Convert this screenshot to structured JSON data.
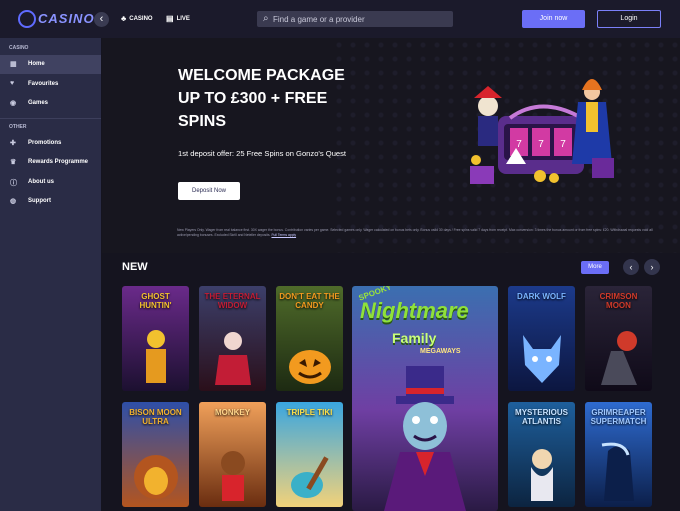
{
  "brand": {
    "logo_text": "CASINO"
  },
  "topnav": [
    {
      "label": "CASINO",
      "icon": "club-icon"
    },
    {
      "label": "LIVE",
      "icon": "cards-icon"
    }
  ],
  "search": {
    "placeholder": "Find a game or a provider"
  },
  "auth": {
    "join": "Join now",
    "login": "Login"
  },
  "sidebar": {
    "section1": "CASINO",
    "items1": [
      {
        "label": "Home",
        "icon": "grid-icon",
        "active": true
      },
      {
        "label": "Favourites",
        "icon": "heart-icon"
      },
      {
        "label": "Games",
        "icon": "gamepad-icon"
      }
    ],
    "section2": "OTHER",
    "items2": [
      {
        "label": "Promotions",
        "icon": "gift-icon"
      },
      {
        "label": "Rewards Programme",
        "icon": "trophy-icon"
      },
      {
        "label": "About us",
        "icon": "info-icon"
      },
      {
        "label": "Support",
        "icon": "support-icon"
      }
    ]
  },
  "hero": {
    "title_lines": [
      "WELCOME PACKAGE",
      "UP TO £300 + FREE",
      "SPINS"
    ],
    "subtitle": "1st deposit offer: 25 Free Spins on Gonzo's Quest",
    "cta": "Deposit Now",
    "terms": "New Players Only. Wager from real balance first. 30X wager the bonus. Contribution varies per game. Selected games only. Wager calculated on bonus bets only. Bonus valid 30 days / Free spins valid 7 days from receipt. Max conversion: 3 times the bonus amount or from free spins: £20. Withdrawal requests void all active/pending bonuses. Excluded Skrill and Neteller deposits.",
    "terms_link": "Full Terms apply"
  },
  "new_section": {
    "title": "NEW",
    "more": "More",
    "prev": "‹",
    "next": "›"
  },
  "games": [
    {
      "title": "GHOST HUNTIN'",
      "bg1": "#6a2a8a",
      "bg2": "#1c1030",
      "accent": "#f2c12e"
    },
    {
      "title": "THE ETERNAL WIDOW",
      "bg1": "#3c3f6a",
      "bg2": "#2a0f1a",
      "accent": "#c21d36"
    },
    {
      "title": "DON'T EAT THE CANDY",
      "bg1": "#4f6b2a",
      "bg2": "#1d2a12",
      "accent": "#f29a1f"
    },
    {
      "title": "DARK WOLF",
      "bg1": "#1c3a8a",
      "bg2": "#0c1640",
      "accent": "#7ab4ff"
    },
    {
      "title": "CRIMSON MOON",
      "bg1": "#2a2438",
      "bg2": "#0f0a18",
      "accent": "#d03a2a"
    },
    {
      "title": "BISON MOON ULTRA",
      "bg1": "#2e4fa8",
      "bg2": "#b3551f",
      "accent": "#f2b22e"
    },
    {
      "title": "MONKEY",
      "bg1": "#f0a05a",
      "bg2": "#6a2d10",
      "accent": "#ffd58a"
    },
    {
      "title": "TRIPLE TIKI",
      "bg1": "#3aa6e0",
      "bg2": "#f2d27a",
      "accent": "#ffe14a"
    },
    {
      "title": "MYSTERIOUS ATLANTIS",
      "bg1": "#1e5f9c",
      "bg2": "#0c2440",
      "accent": "#c7e2ff"
    },
    {
      "title": "GRIMREAPER SUPERMATCH",
      "bg1": "#2e6bd0",
      "bg2": "#0c1f4a",
      "accent": "#a0c8ff"
    }
  ],
  "featured": {
    "spooky": "SPOOKY",
    "title": "Nightmare",
    "sub": "Family",
    "tag": "MEGAWAYS"
  }
}
